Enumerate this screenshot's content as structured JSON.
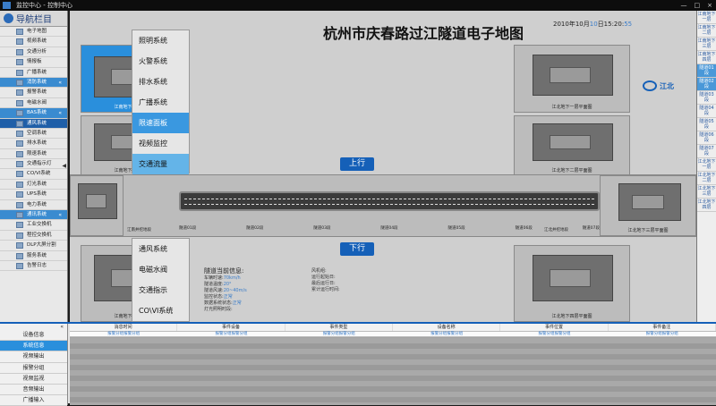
{
  "window": {
    "title": "监控中心 - 控制中心",
    "controls": [
      "—",
      "□",
      "×"
    ]
  },
  "sidebar": {
    "title": "导航栏目",
    "items": [
      {
        "label": "电子地图",
        "type": "item"
      },
      {
        "label": "视频系统",
        "type": "item"
      },
      {
        "label": "交通分析",
        "type": "item"
      },
      {
        "label": "情报板",
        "type": "item"
      },
      {
        "label": "广播系统",
        "type": "item"
      },
      {
        "label": "消防系统",
        "type": "group",
        "chev": "«"
      },
      {
        "label": "报警系统",
        "type": "item"
      },
      {
        "label": "电磁水阀",
        "type": "item"
      },
      {
        "label": "BAS系统",
        "type": "group",
        "chev": "«"
      },
      {
        "label": "通风系统",
        "type": "active"
      },
      {
        "label": "空调系统",
        "type": "item"
      },
      {
        "label": "排水系统",
        "type": "item"
      },
      {
        "label": "限速系统",
        "type": "item"
      },
      {
        "label": "交通指示灯",
        "type": "item"
      },
      {
        "label": "CO/VI系统",
        "type": "item"
      },
      {
        "label": "灯光系统",
        "type": "item"
      },
      {
        "label": "UPS系统",
        "type": "item"
      },
      {
        "label": "电力系统",
        "type": "item"
      },
      {
        "label": "通讯系统",
        "type": "group",
        "chev": "«"
      },
      {
        "label": "工业交换机",
        "type": "item"
      },
      {
        "label": "程控交换机",
        "type": "item"
      },
      {
        "label": "DLP大屏分割",
        "type": "item"
      },
      {
        "label": "服务系统",
        "type": "item"
      },
      {
        "label": "告警日志",
        "type": "item"
      }
    ]
  },
  "map": {
    "title": "杭州市庆春路过江隧道电子地图",
    "time_prefix": "2010年10月",
    "time_day": "10",
    "time_mid": "日15:20:",
    "time_sec": "55",
    "up_label": "上行",
    "down_label": "下行",
    "logo": "江北",
    "panels": {
      "left_top": "江南地下一层平面图",
      "left_mid": "江南地下二层平面图",
      "left_tunnel": "江南井挖地段",
      "left_bottom": "江南地下四层平面图",
      "right_top": "江北地下一层平面图",
      "right_mid": "江北地下二层平面图",
      "right_tunnel": "江北井挖地段",
      "right_far": "江北地下三层平面图",
      "right_bottom": "江北地下四层平面图"
    },
    "segments": [
      "隧道01段",
      "隧道02段",
      "隧道03段",
      "隧道04段",
      "隧道05段",
      "隧道06段",
      "隧道07段"
    ],
    "info": {
      "head": "隧道当前信息:",
      "lines": [
        {
          "k": "车辆时速:",
          "v": "70km/h"
        },
        {
          "k": "隧道温度:",
          "v": "20°"
        },
        {
          "k": "隧道风速:",
          "v": "20~40m/s"
        },
        {
          "k": "监控状态:",
          "v": "正常"
        },
        {
          "k": "数据系统状态:",
          "v": "正常"
        }
      ],
      "extra": "灯光照明时段:",
      "right": [
        "风机组:",
        "运行起始日:",
        "最后运行日:",
        "累计运行时间:"
      ]
    }
  },
  "menu_top": [
    "照明系统",
    "火警系统",
    "排水系统",
    "广播系统",
    "限速面板",
    "视频监控",
    "交通流量"
  ],
  "menu_bottom": [
    "通风系统",
    "电磁水阀",
    "交通指示",
    "CO\\VI系统"
  ],
  "rightbar": [
    "江南地下一层",
    "江南地下二层",
    "江南地下三层",
    "江南地下四层",
    "隧道01段",
    "隧道02段",
    "隧道03段",
    "隧道04段",
    "隧道05段",
    "隧道06段",
    "隧道07段",
    "江北地下一层",
    "江北地下二层",
    "江北地下三层",
    "江北地下四层"
  ],
  "bottom": {
    "tabs": [
      "设备信息",
      "系统信息",
      "视频输出",
      "报警分组",
      "视频监视",
      "音频输出",
      "广播输入"
    ],
    "columns": [
      "消息时间",
      "事件设备",
      "事件类型",
      "设备名称",
      "事件位置",
      "事件备注"
    ],
    "row": [
      "报警分组报警分组",
      "报警分组报警分组",
      "报警分组报警分组",
      "报警分组报警分组",
      "报警分组报警分组",
      "报警分组报警分组"
    ]
  }
}
